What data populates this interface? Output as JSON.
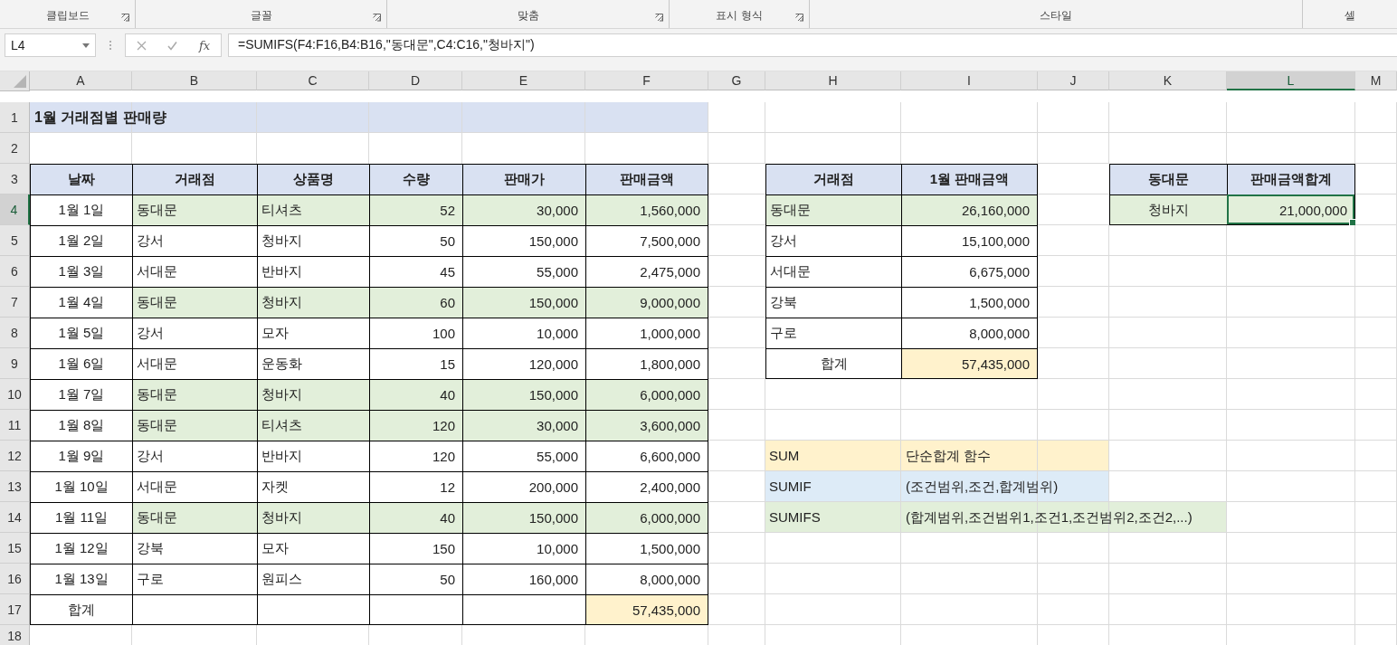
{
  "ribbon": {
    "groups": [
      {
        "label": "클립보드",
        "launcher": true
      },
      {
        "label": "글꼴",
        "launcher": true
      },
      {
        "label": "맞춤",
        "launcher": true
      },
      {
        "label": "표시 형식",
        "launcher": true
      },
      {
        "label": "스타일",
        "launcher": false
      },
      {
        "label": "셀",
        "launcher": false
      }
    ]
  },
  "formula_bar": {
    "name_box": "L4",
    "function_button": "fx",
    "formula": "=SUMIFS(F4:F16,B4:B16,\"동대문\",C4:C16,\"청바지\")"
  },
  "columns": [
    {
      "label": "A",
      "selected": false
    },
    {
      "label": "B",
      "selected": false
    },
    {
      "label": "C",
      "selected": false
    },
    {
      "label": "D",
      "selected": false
    },
    {
      "label": "E",
      "selected": false
    },
    {
      "label": "F",
      "selected": false
    },
    {
      "label": "G",
      "selected": false
    },
    {
      "label": "H",
      "selected": false
    },
    {
      "label": "I",
      "selected": false
    },
    {
      "label": "J",
      "selected": false
    },
    {
      "label": "K",
      "selected": false
    },
    {
      "label": "L",
      "selected": true
    },
    {
      "label": "M",
      "selected": false
    }
  ],
  "rows": [
    {
      "label": "1",
      "selected": false,
      "cells": [
        {
          "text": "1월 거래점별 판매량",
          "kind": "title",
          "color": "#d9e1f2",
          "bordered": false
        },
        {
          "color": "#d9e1f2",
          "bordered": false
        },
        {
          "color": "#d9e1f2",
          "bordered": false
        },
        {
          "color": "#d9e1f2",
          "bordered": false
        },
        {
          "color": "#d9e1f2",
          "bordered": false
        },
        {
          "color": "#d9e1f2",
          "bordered": false
        },
        {
          "bordered": false
        },
        {
          "bordered": false
        },
        {
          "bordered": false
        },
        {
          "bordered": false
        },
        {
          "bordered": false
        },
        {
          "bordered": false
        },
        {
          "bordered": false
        }
      ]
    },
    {
      "label": "2",
      "selected": false,
      "cells": [
        {
          "bordered": false
        },
        {
          "bordered": false
        },
        {
          "bordered": false
        },
        {
          "bordered": false
        },
        {
          "bordered": false
        },
        {
          "bordered": false
        },
        {
          "bordered": false
        },
        {
          "bordered": false
        },
        {
          "bordered": false
        },
        {
          "bordered": false
        },
        {
          "bordered": false
        },
        {
          "bordered": false
        },
        {
          "bordered": false
        }
      ]
    },
    {
      "label": "3",
      "selected": false,
      "cells": [
        {
          "text": "날짜",
          "kind": "heading",
          "color": "#d9e1f2",
          "bordered": true
        },
        {
          "text": "거래점",
          "kind": "heading",
          "color": "#d9e1f2",
          "bordered": true
        },
        {
          "text": "상품명",
          "kind": "heading",
          "color": "#d9e1f2",
          "bordered": true
        },
        {
          "text": "수량",
          "kind": "heading",
          "color": "#d9e1f2",
          "bordered": true
        },
        {
          "text": "판매가",
          "kind": "heading",
          "color": "#d9e1f2",
          "bordered": true
        },
        {
          "text": "판매금액",
          "kind": "heading",
          "color": "#d9e1f2",
          "bordered": true
        },
        {
          "bordered": false
        },
        {
          "text": "거래점",
          "kind": "heading",
          "color": "#d9e1f2",
          "bordered": true
        },
        {
          "text": "1월 판매금액",
          "kind": "heading",
          "color": "#d9e1f2",
          "bordered": true
        },
        {
          "bordered": false
        },
        {
          "text": "동대문",
          "kind": "heading",
          "color": "#d9e1f2",
          "bordered": true
        },
        {
          "text": "판매금액합계",
          "kind": "heading",
          "color": "#d9e1f2",
          "bordered": true
        },
        {
          "bordered": false
        }
      ]
    },
    {
      "label": "4",
      "selected": true,
      "cells": [
        {
          "text": "1월 1일",
          "kind": "center",
          "bordered": true
        },
        {
          "text": "동대문",
          "kind": "text",
          "color": "#e2efda",
          "bordered": true
        },
        {
          "text": "티셔츠",
          "kind": "text",
          "color": "#e2efda",
          "bordered": true
        },
        {
          "text": "52",
          "kind": "number",
          "color": "#e2efda",
          "bordered": true
        },
        {
          "text": "30,000",
          "kind": "number",
          "color": "#e2efda",
          "bordered": true
        },
        {
          "text": "1,560,000",
          "kind": "number",
          "color": "#e2efda",
          "bordered": true
        },
        {
          "bordered": false
        },
        {
          "text": "동대문",
          "kind": "text",
          "color": "#e2efda",
          "bordered": true
        },
        {
          "text": "26,160,000",
          "kind": "number",
          "color": "#e2efda",
          "bordered": true
        },
        {
          "bordered": false
        },
        {
          "text": "청바지",
          "kind": "center",
          "color": "#e2efda",
          "bordered": true
        },
        {
          "text": "21,000,000",
          "kind": "number",
          "color": "#e2efda",
          "bordered": true
        },
        {
          "bordered": false
        }
      ]
    },
    {
      "label": "5",
      "selected": false,
      "cells": [
        {
          "text": "1월 2일",
          "kind": "center",
          "bordered": true
        },
        {
          "text": "강서",
          "kind": "text",
          "bordered": true
        },
        {
          "text": "청바지",
          "kind": "text",
          "bordered": true
        },
        {
          "text": "50",
          "kind": "number",
          "bordered": true
        },
        {
          "text": "150,000",
          "kind": "number",
          "bordered": true
        },
        {
          "text": "7,500,000",
          "kind": "number",
          "bordered": true
        },
        {
          "bordered": false
        },
        {
          "text": "강서",
          "kind": "text",
          "bordered": true
        },
        {
          "text": "15,100,000",
          "kind": "number",
          "bordered": true
        },
        {
          "bordered": false
        },
        {
          "bordered": false
        },
        {
          "bordered": false
        },
        {
          "bordered": false
        }
      ]
    },
    {
      "label": "6",
      "selected": false,
      "cells": [
        {
          "text": "1월 3일",
          "kind": "center",
          "bordered": true
        },
        {
          "text": "서대문",
          "kind": "text",
          "bordered": true
        },
        {
          "text": "반바지",
          "kind": "text",
          "bordered": true
        },
        {
          "text": "45",
          "kind": "number",
          "bordered": true
        },
        {
          "text": "55,000",
          "kind": "number",
          "bordered": true
        },
        {
          "text": "2,475,000",
          "kind": "number",
          "bordered": true
        },
        {
          "bordered": false
        },
        {
          "text": "서대문",
          "kind": "text",
          "bordered": true
        },
        {
          "text": "6,675,000",
          "kind": "number",
          "bordered": true
        },
        {
          "bordered": false
        },
        {
          "bordered": false
        },
        {
          "bordered": false
        },
        {
          "bordered": false
        }
      ]
    },
    {
      "label": "7",
      "selected": false,
      "cells": [
        {
          "text": "1월 4일",
          "kind": "center",
          "bordered": true
        },
        {
          "text": "동대문",
          "kind": "text",
          "color": "#e2efda",
          "bordered": true
        },
        {
          "text": "청바지",
          "kind": "text",
          "color": "#e2efda",
          "bordered": true
        },
        {
          "text": "60",
          "kind": "number",
          "color": "#e2efda",
          "bordered": true
        },
        {
          "text": "150,000",
          "kind": "number",
          "color": "#e2efda",
          "bordered": true
        },
        {
          "text": "9,000,000",
          "kind": "number",
          "color": "#e2efda",
          "bordered": true
        },
        {
          "bordered": false
        },
        {
          "text": "강북",
          "kind": "text",
          "bordered": true
        },
        {
          "text": "1,500,000",
          "kind": "number",
          "bordered": true
        },
        {
          "bordered": false
        },
        {
          "bordered": false
        },
        {
          "bordered": false
        },
        {
          "bordered": false
        }
      ]
    },
    {
      "label": "8",
      "selected": false,
      "cells": [
        {
          "text": "1월 5일",
          "kind": "center",
          "bordered": true
        },
        {
          "text": "강서",
          "kind": "text",
          "bordered": true
        },
        {
          "text": "모자",
          "kind": "text",
          "bordered": true
        },
        {
          "text": "100",
          "kind": "number",
          "bordered": true
        },
        {
          "text": "10,000",
          "kind": "number",
          "bordered": true
        },
        {
          "text": "1,000,000",
          "kind": "number",
          "bordered": true
        },
        {
          "bordered": false
        },
        {
          "text": "구로",
          "kind": "text",
          "bordered": true
        },
        {
          "text": "8,000,000",
          "kind": "number",
          "bordered": true
        },
        {
          "bordered": false
        },
        {
          "bordered": false
        },
        {
          "bordered": false
        },
        {
          "bordered": false
        }
      ]
    },
    {
      "label": "9",
      "selected": false,
      "cells": [
        {
          "text": "1월 6일",
          "kind": "center",
          "bordered": true
        },
        {
          "text": "서대문",
          "kind": "text",
          "bordered": true
        },
        {
          "text": "운동화",
          "kind": "text",
          "bordered": true
        },
        {
          "text": "15",
          "kind": "number",
          "bordered": true
        },
        {
          "text": "120,000",
          "kind": "number",
          "bordered": true
        },
        {
          "text": "1,800,000",
          "kind": "number",
          "bordered": true
        },
        {
          "bordered": false
        },
        {
          "text": "합계",
          "kind": "center",
          "bordered": true
        },
        {
          "text": "57,435,000",
          "kind": "number",
          "color": "#fff2cc",
          "bordered": true
        },
        {
          "bordered": false
        },
        {
          "bordered": false
        },
        {
          "bordered": false
        },
        {
          "bordered": false
        }
      ]
    },
    {
      "label": "10",
      "selected": false,
      "cells": [
        {
          "text": "1월 7일",
          "kind": "center",
          "bordered": true
        },
        {
          "text": "동대문",
          "kind": "text",
          "color": "#e2efda",
          "bordered": true
        },
        {
          "text": "청바지",
          "kind": "text",
          "color": "#e2efda",
          "bordered": true
        },
        {
          "text": "40",
          "kind": "number",
          "color": "#e2efda",
          "bordered": true
        },
        {
          "text": "150,000",
          "kind": "number",
          "color": "#e2efda",
          "bordered": true
        },
        {
          "text": "6,000,000",
          "kind": "number",
          "color": "#e2efda",
          "bordered": true
        },
        {
          "bordered": false
        },
        {
          "bordered": false
        },
        {
          "bordered": false
        },
        {
          "bordered": false
        },
        {
          "bordered": false
        },
        {
          "bordered": false
        },
        {
          "bordered": false
        }
      ]
    },
    {
      "label": "11",
      "selected": false,
      "cells": [
        {
          "text": "1월 8일",
          "kind": "center",
          "bordered": true
        },
        {
          "text": "동대문",
          "kind": "text",
          "color": "#e2efda",
          "bordered": true
        },
        {
          "text": "티셔츠",
          "kind": "text",
          "color": "#e2efda",
          "bordered": true
        },
        {
          "text": "120",
          "kind": "number",
          "color": "#e2efda",
          "bordered": true
        },
        {
          "text": "30,000",
          "kind": "number",
          "color": "#e2efda",
          "bordered": true
        },
        {
          "text": "3,600,000",
          "kind": "number",
          "color": "#e2efda",
          "bordered": true
        },
        {
          "bordered": false
        },
        {
          "bordered": false
        },
        {
          "bordered": false
        },
        {
          "bordered": false
        },
        {
          "bordered": false
        },
        {
          "bordered": false
        },
        {
          "bordered": false
        }
      ]
    },
    {
      "label": "12",
      "selected": false,
      "cells": [
        {
          "text": "1월 9일",
          "kind": "center",
          "bordered": true
        },
        {
          "text": "강서",
          "kind": "text",
          "bordered": true
        },
        {
          "text": "반바지",
          "kind": "text",
          "bordered": true
        },
        {
          "text": "120",
          "kind": "number",
          "bordered": true
        },
        {
          "text": "55,000",
          "kind": "number",
          "bordered": true
        },
        {
          "text": "6,600,000",
          "kind": "number",
          "bordered": true
        },
        {
          "bordered": false
        },
        {
          "text": "SUM",
          "kind": "text",
          "color": "#fff2cc",
          "bordered": false
        },
        {
          "text": "단순합계 함수",
          "kind": "text",
          "color": "#fff2cc",
          "bordered": false
        },
        {
          "color": "#fff2cc",
          "bordered": false
        },
        {
          "bordered": false
        },
        {
          "bordered": false
        },
        {
          "bordered": false
        }
      ]
    },
    {
      "label": "13",
      "selected": false,
      "cells": [
        {
          "text": "1월 10일",
          "kind": "center",
          "bordered": true
        },
        {
          "text": "서대문",
          "kind": "text",
          "bordered": true
        },
        {
          "text": "자켓",
          "kind": "text",
          "bordered": true
        },
        {
          "text": "12",
          "kind": "number",
          "bordered": true
        },
        {
          "text": "200,000",
          "kind": "number",
          "bordered": true
        },
        {
          "text": "2,400,000",
          "kind": "number",
          "bordered": true
        },
        {
          "bordered": false
        },
        {
          "text": "SUMIF",
          "kind": "text",
          "color": "#ddebf7",
          "bordered": false
        },
        {
          "text": "(조건범위,조건,합계범위)",
          "kind": "text",
          "color": "#ddebf7",
          "bordered": false
        },
        {
          "color": "#ddebf7",
          "bordered": false
        },
        {
          "bordered": false
        },
        {
          "bordered": false
        },
        {
          "bordered": false
        }
      ]
    },
    {
      "label": "14",
      "selected": false,
      "cells": [
        {
          "text": "1월 11일",
          "kind": "center",
          "bordered": true
        },
        {
          "text": "동대문",
          "kind": "text",
          "color": "#e2efda",
          "bordered": true
        },
        {
          "text": "청바지",
          "kind": "text",
          "color": "#e2efda",
          "bordered": true
        },
        {
          "text": "40",
          "kind": "number",
          "color": "#e2efda",
          "bordered": true
        },
        {
          "text": "150,000",
          "kind": "number",
          "color": "#e2efda",
          "bordered": true
        },
        {
          "text": "6,000,000",
          "kind": "number",
          "color": "#e2efda",
          "bordered": true
        },
        {
          "bordered": false
        },
        {
          "text": "SUMIFS",
          "kind": "text",
          "color": "#e2efda",
          "bordered": false
        },
        {
          "text": "(합계범위,조건범위1,조건1,조건범위2,조건2,...)",
          "kind": "text",
          "color": "#e2efda",
          "bordered": false
        },
        {
          "color": "#e2efda",
          "bordered": false
        },
        {
          "color": "#e2efda",
          "bordered": false
        },
        {
          "bordered": false
        },
        {
          "bordered": false
        }
      ]
    },
    {
      "label": "15",
      "selected": false,
      "cells": [
        {
          "text": "1월 12일",
          "kind": "center",
          "bordered": true
        },
        {
          "text": "강북",
          "kind": "text",
          "bordered": true
        },
        {
          "text": "모자",
          "kind": "text",
          "bordered": true
        },
        {
          "text": "150",
          "kind": "number",
          "bordered": true
        },
        {
          "text": "10,000",
          "kind": "number",
          "bordered": true
        },
        {
          "text": "1,500,000",
          "kind": "number",
          "bordered": true
        },
        {
          "bordered": false
        },
        {
          "bordered": false
        },
        {
          "bordered": false
        },
        {
          "bordered": false
        },
        {
          "bordered": false
        },
        {
          "bordered": false
        },
        {
          "bordered": false
        }
      ]
    },
    {
      "label": "16",
      "selected": false,
      "cells": [
        {
          "text": "1월 13일",
          "kind": "center",
          "bordered": true
        },
        {
          "text": "구로",
          "kind": "text",
          "bordered": true
        },
        {
          "text": "원피스",
          "kind": "text",
          "bordered": true
        },
        {
          "text": "50",
          "kind": "number",
          "bordered": true
        },
        {
          "text": "160,000",
          "kind": "number",
          "bordered": true
        },
        {
          "text": "8,000,000",
          "kind": "number",
          "bordered": true
        },
        {
          "bordered": false
        },
        {
          "bordered": false
        },
        {
          "bordered": false
        },
        {
          "bordered": false
        },
        {
          "bordered": false
        },
        {
          "bordered": false
        },
        {
          "bordered": false
        }
      ]
    },
    {
      "label": "17",
      "selected": false,
      "cells": [
        {
          "text": "합계",
          "kind": "center",
          "bordered": true
        },
        {
          "bordered": true
        },
        {
          "bordered": true
        },
        {
          "bordered": true
        },
        {
          "bordered": true
        },
        {
          "text": "57,435,000",
          "kind": "number",
          "color": "#fff2cc",
          "bordered": true
        },
        {
          "bordered": false
        },
        {
          "bordered": false
        },
        {
          "bordered": false
        },
        {
          "bordered": false
        },
        {
          "bordered": false
        },
        {
          "bordered": false
        },
        {
          "bordered": false
        }
      ]
    },
    {
      "label": "18",
      "selected": false,
      "cells": [
        {
          "bordered": false
        },
        {
          "bordered": false
        },
        {
          "bordered": false
        },
        {
          "bordered": false
        },
        {
          "bordered": false
        },
        {
          "bordered": false
        },
        {
          "bordered": false
        },
        {
          "bordered": false
        },
        {
          "bordered": false
        },
        {
          "bordered": false
        },
        {
          "bordered": false
        },
        {
          "bordered": false
        },
        {
          "bordered": false
        }
      ]
    }
  ]
}
